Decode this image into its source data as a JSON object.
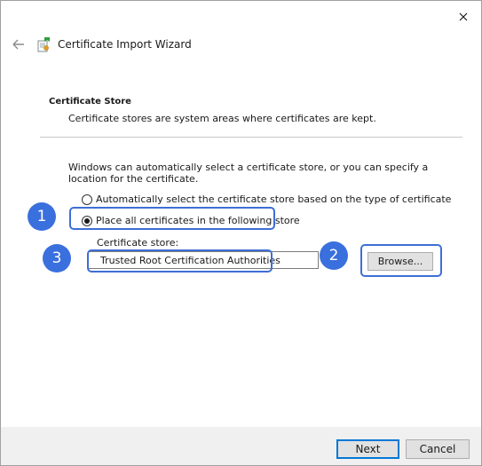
{
  "window": {
    "title": "Certificate Import Wizard"
  },
  "section": {
    "title": "Certificate Store",
    "description": "Certificate stores are system areas where certificates are kept."
  },
  "intro": "Windows can automatically select a certificate store, or you can specify a location for the certificate.",
  "options": {
    "auto": {
      "label": "Automatically select the certificate store based on the type of certificate",
      "checked": false
    },
    "place": {
      "label": "Place all certificates in the following store",
      "checked": true
    }
  },
  "store": {
    "label": "Certificate store:",
    "value": "Trusted Root Certification Authorities",
    "browse_label": "Browse..."
  },
  "footer": {
    "next_label": "Next",
    "cancel_label": "Cancel"
  },
  "markers": [
    "1",
    "2",
    "3"
  ],
  "colors": {
    "accent": "#3a6fde",
    "highlight": "#3d6fd6",
    "default_button_border": "#0078d7"
  },
  "icons": {
    "close": "close-icon",
    "back": "back-arrow-icon",
    "wizard": "certificate-icon"
  }
}
